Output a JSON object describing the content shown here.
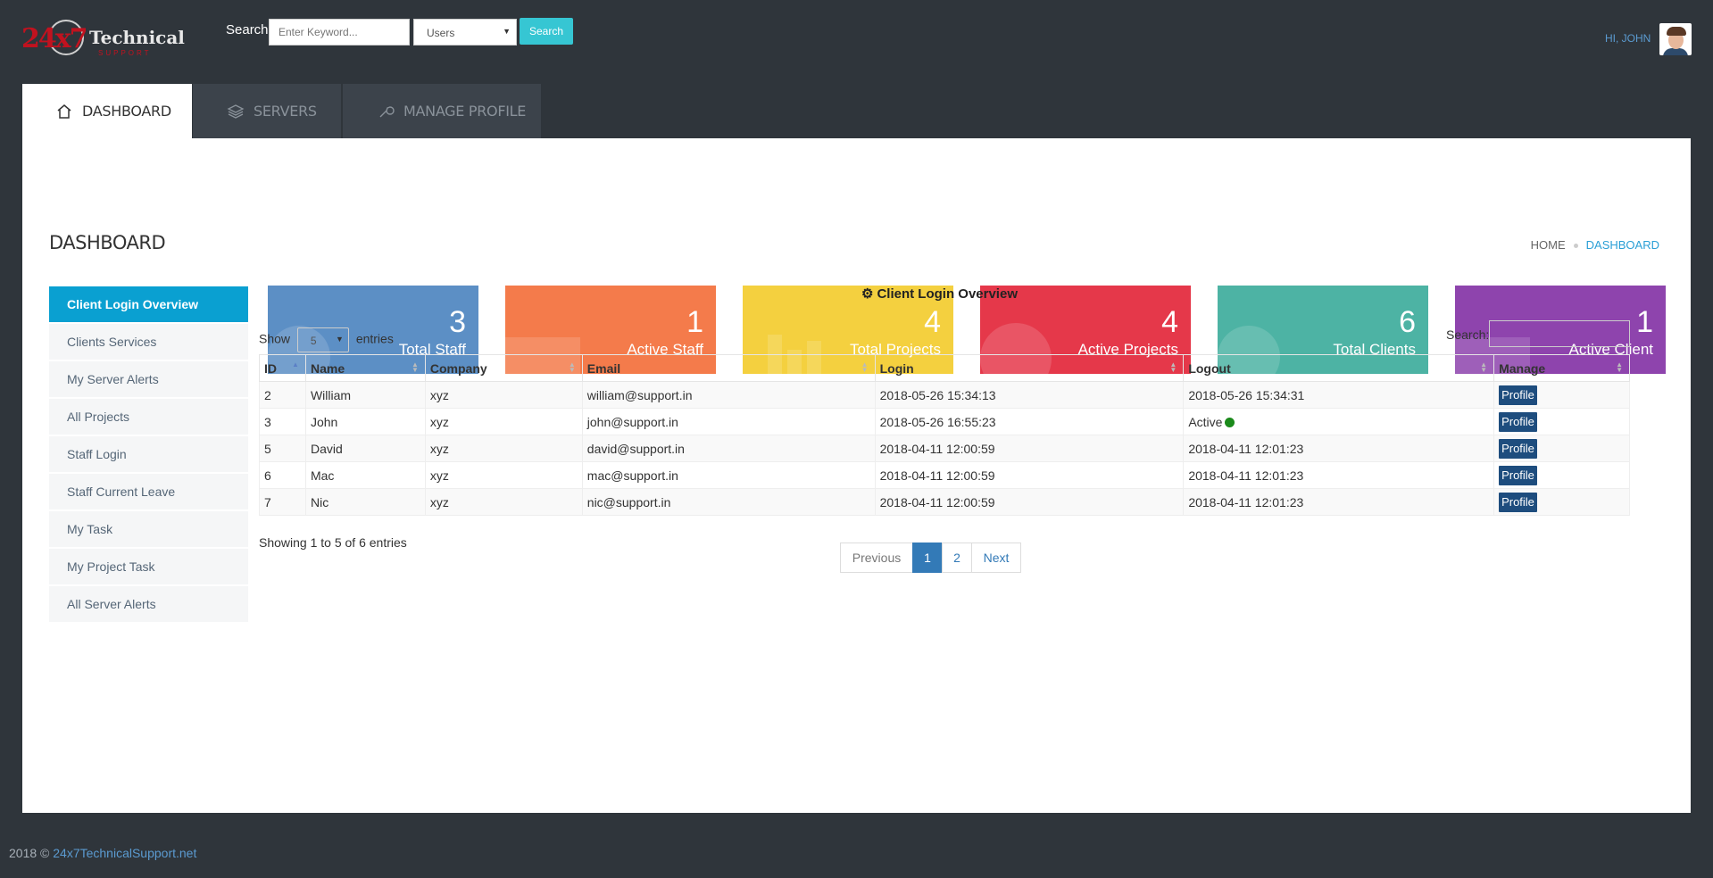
{
  "header": {
    "logo_number": "24x7",
    "logo_text": "Technical",
    "logo_sub": "SUPPORT",
    "search_label": "Search",
    "search_placeholder": "Enter Keyword...",
    "search_type": "Users",
    "search_button": "Search",
    "greeting": "HI, JOHN"
  },
  "tabs": [
    {
      "label": "DASHBOARD",
      "icon": "home-icon",
      "active": true
    },
    {
      "label": "SERVERS",
      "icon": "layers-icon",
      "active": false
    },
    {
      "label": "MANAGE PROFILE",
      "icon": "wrench-icon",
      "active": false
    }
  ],
  "page": {
    "title": "DASHBOARD",
    "breadcrumb": [
      "HOME",
      "DASHBOARD"
    ]
  },
  "sidebar": {
    "items": [
      {
        "label": "Client Login Overview",
        "active": true
      },
      {
        "label": "Clients Services"
      },
      {
        "label": "My Server Alerts"
      },
      {
        "label": "All Projects"
      },
      {
        "label": "Staff Login"
      },
      {
        "label": "Staff Current Leave"
      },
      {
        "label": "My Task"
      },
      {
        "label": "My Project Task"
      },
      {
        "label": "All Server Alerts"
      }
    ]
  },
  "stats": [
    {
      "value": "3",
      "label": "Total Staff",
      "color": "#5c8fc5"
    },
    {
      "value": "1",
      "label": "Active Staff",
      "color": "#f47b4b"
    },
    {
      "value": "4",
      "label": "Total Projects",
      "color": "#f4d03f"
    },
    {
      "value": "4",
      "label": "Active Projects",
      "color": "#e5384a"
    },
    {
      "value": "6",
      "label": "Total Clients",
      "color": "#4db3a4"
    },
    {
      "value": "1",
      "label": "Active Client",
      "color": "#8e44ad"
    }
  ],
  "table": {
    "title": "Client Login Overview",
    "show_label": "Show",
    "page_size": "5",
    "entries_label": "entries",
    "search_label": "Search:",
    "columns": [
      "ID",
      "Name",
      "Company",
      "Email",
      "Login",
      "Logout",
      "Manage"
    ],
    "rows": [
      {
        "id": "2",
        "name": "William",
        "company": "xyz",
        "email": "william@support.in",
        "login": "2018-05-26 15:34:13",
        "logout": "2018-05-26 15:34:31",
        "manage": "Profile"
      },
      {
        "id": "3",
        "name": "John",
        "company": "xyz",
        "email": "john@support.in",
        "login": "2018-05-26 16:55:23",
        "logout": "Active",
        "manage": "Profile"
      },
      {
        "id": "5",
        "name": "David",
        "company": "xyz",
        "email": "david@support.in",
        "login": "2018-04-11 12:00:59",
        "logout": "2018-04-11 12:01:23",
        "manage": "Profile"
      },
      {
        "id": "6",
        "name": "Mac",
        "company": "xyz",
        "email": "mac@support.in",
        "login": "2018-04-11 12:00:59",
        "logout": "2018-04-11 12:01:23",
        "manage": "Profile"
      },
      {
        "id": "7",
        "name": "Nic",
        "company": "xyz",
        "email": "nic@support.in",
        "login": "2018-04-11 12:00:59",
        "logout": "2018-04-11 12:01:23",
        "manage": "Profile"
      }
    ],
    "info": "Showing 1 to 5 of 6 entries",
    "pagination": {
      "previous": "Previous",
      "pages": [
        "1",
        "2"
      ],
      "next": "Next"
    }
  },
  "footer": {
    "prefix": "2018 ©",
    "link": "24x7TechnicalSupport.net"
  }
}
